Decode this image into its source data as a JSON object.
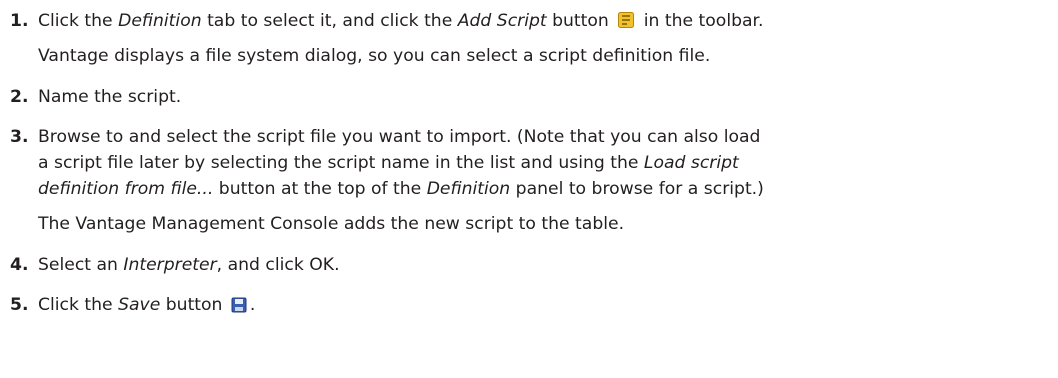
{
  "steps": [
    {
      "number": "1.",
      "text_a": "Click the ",
      "tab_name": "Definition",
      "text_b": " tab to select it, and click the ",
      "button_name": "Add Script",
      "text_c": " button ",
      "icon": "add-script-icon",
      "text_d": " in the toolbar.",
      "result": "Vantage displays a file system dialog, so you can select a script definition file."
    },
    {
      "number": "2.",
      "text": "Name the script."
    },
    {
      "number": "3.",
      "line1": "Browse to and select the script file you want to import. (Note that you can also load",
      "line2_a": "a script file later by selecting the script name in the list and using the ",
      "line2_em": "Load script",
      "line3_em": "definition from file...",
      "line3_b": " button at the top of the ",
      "line3_em2": "Definition",
      "line3_c": " panel to browse for a script.)",
      "result": "The Vantage Management Console adds the new script to the table."
    },
    {
      "number": "4.",
      "text_a": "Select an ",
      "em": "Interpreter",
      "text_b": ", and click OK."
    },
    {
      "number": "5.",
      "text_a": "Click the ",
      "em": "Save",
      "text_b": " button ",
      "icon": "save-icon",
      "text_c": "."
    }
  ],
  "colors": {
    "text": "#231f20",
    "add_script_icon": "#f2c12e",
    "save_icon": "#3a5fb0"
  }
}
